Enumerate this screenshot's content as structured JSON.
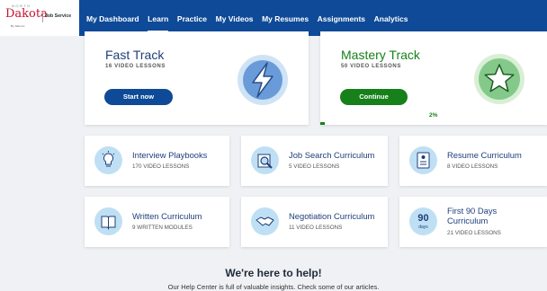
{
  "logo": {
    "north": "NORTH",
    "dakota": "Dakota",
    "job_service": "Job Service",
    "by": "By Jobs Inc"
  },
  "nav": {
    "items": [
      {
        "label": "My Dashboard"
      },
      {
        "label": "Learn",
        "active": true
      },
      {
        "label": "Practice"
      },
      {
        "label": "My Videos"
      },
      {
        "label": "My Resumes"
      },
      {
        "label": "Assignments"
      },
      {
        "label": "Analytics"
      }
    ]
  },
  "tracks": {
    "fast": {
      "title": "Fast Track",
      "subtitle": "16 VIDEO LESSONS",
      "button": "Start now",
      "color": "#0e4a97",
      "icon": "lightning-bolt-icon"
    },
    "mastery": {
      "title": "Mastery Track",
      "subtitle": "50 VIDEO LESSONS",
      "button": "Continue",
      "color": "#17801b",
      "icon": "star-icon",
      "progress_label": "2%",
      "progress_fraction": 0.02
    }
  },
  "curricula": [
    {
      "title": "Interview Playbooks",
      "subtitle": "170 VIDEO LESSONS",
      "icon": "lightbulb-icon"
    },
    {
      "title": "Job Search Curriculum",
      "subtitle": "5 VIDEO LESSONS",
      "icon": "magnifier-icon"
    },
    {
      "title": "Resume Curriculum",
      "subtitle": "8 VIDEO LESSONS",
      "icon": "resume-icon"
    },
    {
      "title": "Written Curriculum",
      "subtitle": "9 WRITTEN MODULES",
      "icon": "book-icon"
    },
    {
      "title": "Negotiation Curriculum",
      "subtitle": "11 VIDEO LESSONS",
      "icon": "handshake-icon"
    },
    {
      "title": "First 90 Days Curriculum",
      "title_line1": "First 90 Days",
      "title_line2": "Curriculum",
      "subtitle": "21 VIDEO LESSONS",
      "icon": "90-days-icon",
      "icon_number": "90",
      "icon_unit": "days"
    }
  ],
  "help": {
    "title": "We're here to help!",
    "subtitle": "Our Help Center is full of valuable insights. Check some of our articles."
  }
}
